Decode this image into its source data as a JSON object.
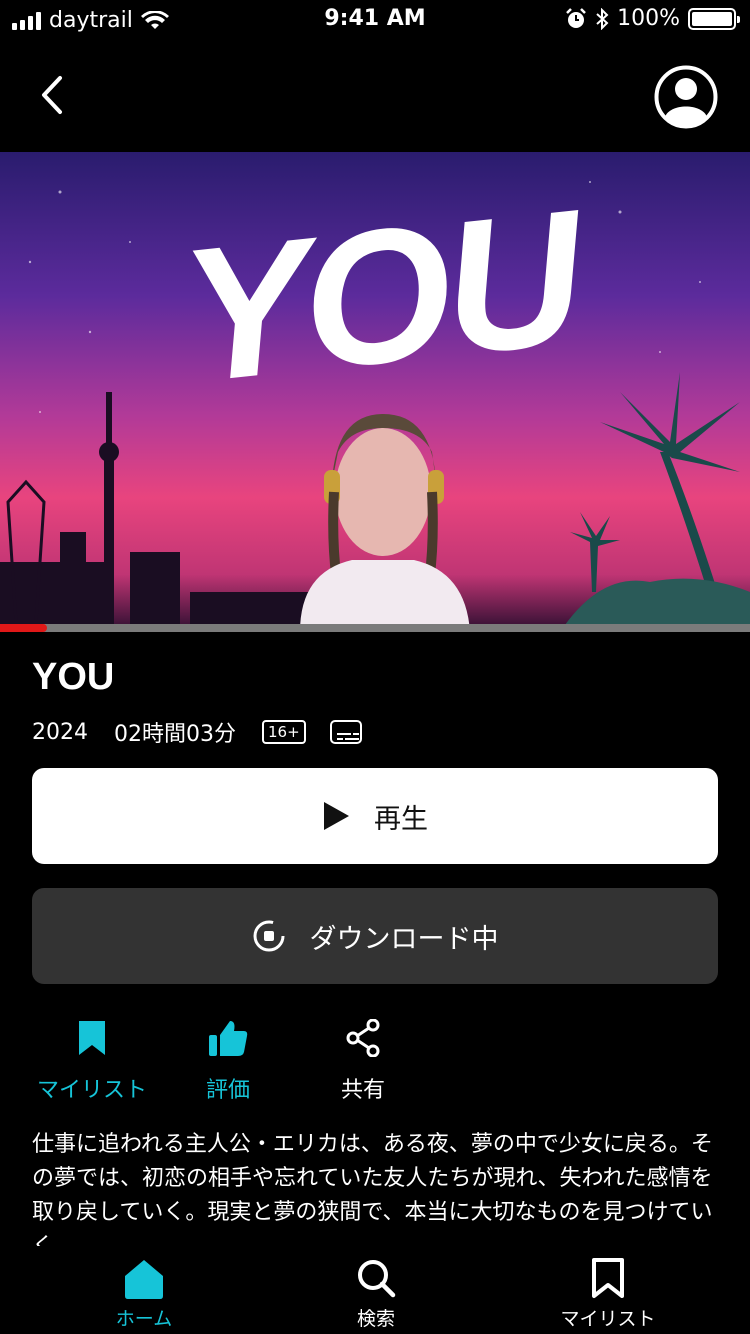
{
  "status_bar": {
    "carrier": "daytrail",
    "time": "9:41 AM",
    "battery": "100%"
  },
  "title": {
    "hero_logo_text": "YOU",
    "heading": "YOU"
  },
  "meta": {
    "year": "2024",
    "duration": "02時間03分",
    "rating": "16+"
  },
  "playback": {
    "progress_fraction": 0.063
  },
  "buttons": {
    "play_label": "再生",
    "download_label": "ダウンロード中"
  },
  "actions": {
    "mylist_label": "マイリスト",
    "rate_label": "評価",
    "share_label": "共有"
  },
  "description": "仕事に追われる主人公・エリカは、ある夜、夢の中で少女に戻る。その夢では、初恋の相手や忘れていた友人たちが現れ、失われた感情を取り戻していく。現実と夢の狭間で、本当に大切なものを見つけていく。",
  "tabbar": {
    "home_label": "ホーム",
    "search_label": "検索",
    "mylist_label": "マイリスト"
  },
  "colors": {
    "accent": "#16c4d8",
    "progress": "#e01818"
  }
}
